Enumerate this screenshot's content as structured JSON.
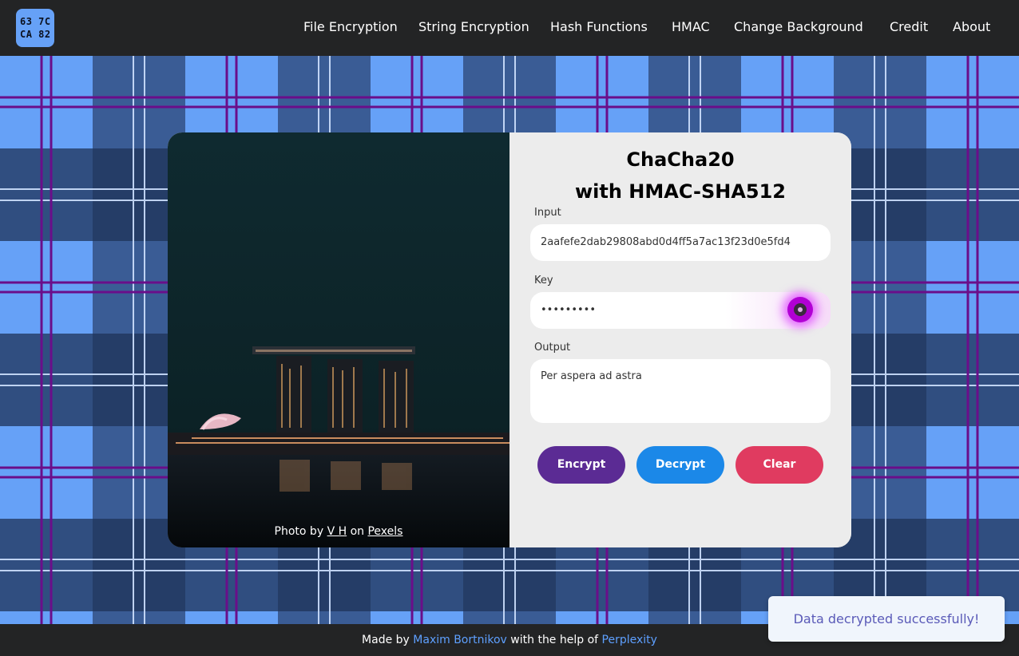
{
  "header": {
    "logo_line1": "63 7C",
    "logo_line2": "CA 82",
    "nav": [
      {
        "label": "File Encryption"
      },
      {
        "label": "String Encryption"
      },
      {
        "label": "Hash Functions"
      },
      {
        "label": "HMAC"
      },
      {
        "label": "Change Background"
      },
      {
        "label": "Credit"
      },
      {
        "label": "About"
      }
    ]
  },
  "card": {
    "title_line1": "ChaCha20",
    "title_line2": "with HMAC-SHA512",
    "photo_credit": {
      "prefix": "Photo by",
      "author": "V H",
      "middle": "on",
      "site": "Pexels"
    },
    "input": {
      "label": "Input",
      "value": "2aafefe2dab29808abd0d4ff5a7ac13f23d0e5fd4"
    },
    "key": {
      "label": "Key",
      "value": "•••••••••"
    },
    "output": {
      "label": "Output",
      "value": "Per aspera ad astra"
    },
    "buttons": {
      "encrypt": "Encrypt",
      "decrypt": "Decrypt",
      "clear": "Clear"
    }
  },
  "footer": {
    "prefix": "Made by",
    "author": "Maxim Bortnikov",
    "middle": "with the help of",
    "tool": "Perplexity"
  },
  "toast": {
    "message": "Data decrypted successfully!"
  },
  "colors": {
    "header_bg": "#232425",
    "tartan_light": "#66a1f7",
    "tartan_mid": "#33507e",
    "tartan_dark": "#1b2844",
    "tartan_stripe_purple": "#6a0e8a",
    "encrypt_button": "#5b2b94",
    "decrypt_button": "#1b88e8",
    "clear_button": "#e03b60",
    "link": "#5ea0ff"
  }
}
